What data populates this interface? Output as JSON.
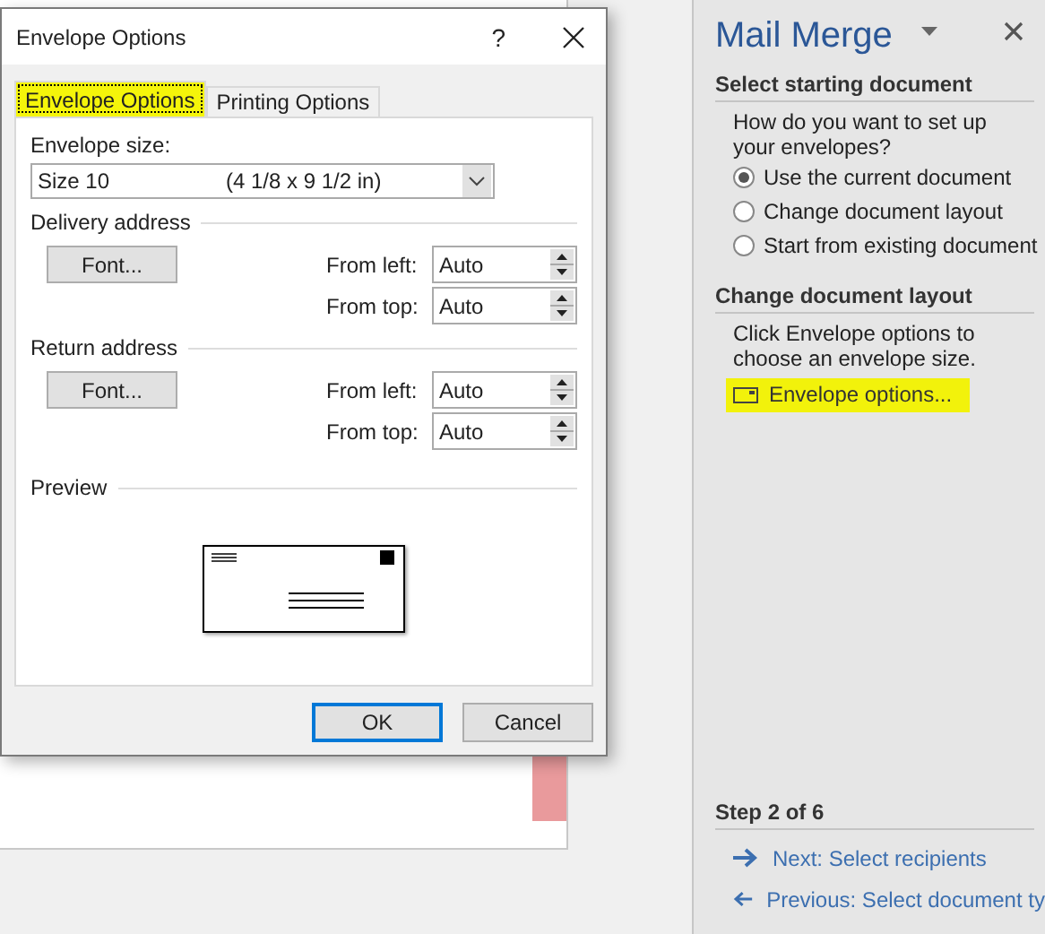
{
  "dialog": {
    "title": "Envelope Options",
    "help": "?",
    "tabs": [
      {
        "label": "Envelope Options",
        "selected": true,
        "highlighted": true
      },
      {
        "label": "Printing Options",
        "selected": false,
        "highlighted": false
      }
    ],
    "envelope_size": {
      "label": "Envelope size:",
      "value": "Size 10",
      "dimensions": "(4 1/8 x 9 1/2 in)"
    },
    "groups": [
      {
        "title": "Delivery address",
        "button": "Font...",
        "fields": [
          {
            "label": "From left:",
            "value": "Auto"
          },
          {
            "label": "From top:",
            "value": "Auto"
          }
        ]
      },
      {
        "title": "Return address",
        "button": "Font...",
        "fields": [
          {
            "label": "From left:",
            "value": "Auto"
          },
          {
            "label": "From top:",
            "value": "Auto"
          }
        ]
      }
    ],
    "preview_label": "Preview",
    "buttons": [
      {
        "label": "OK",
        "default": true
      },
      {
        "label": "Cancel",
        "default": false
      }
    ]
  },
  "pane": {
    "title": "Mail Merge",
    "sections": [
      {
        "heading": "Select starting document",
        "text": "How do you want to set up your envelopes?",
        "options": [
          {
            "label": "Use the current document",
            "selected": true
          },
          {
            "label": "Change document layout",
            "selected": false
          },
          {
            "label": "Start from existing document",
            "selected": false
          }
        ]
      },
      {
        "heading": "Change document layout",
        "text": "Click Envelope options to choose an envelope size.",
        "link": {
          "label": "Envelope options...",
          "highlighted": true
        }
      }
    ],
    "step": "Step 2 of 6",
    "nav": [
      {
        "kind": "next",
        "label": "Next: Select recipients"
      },
      {
        "kind": "previous",
        "label": "Previous: Select document ty"
      }
    ]
  }
}
